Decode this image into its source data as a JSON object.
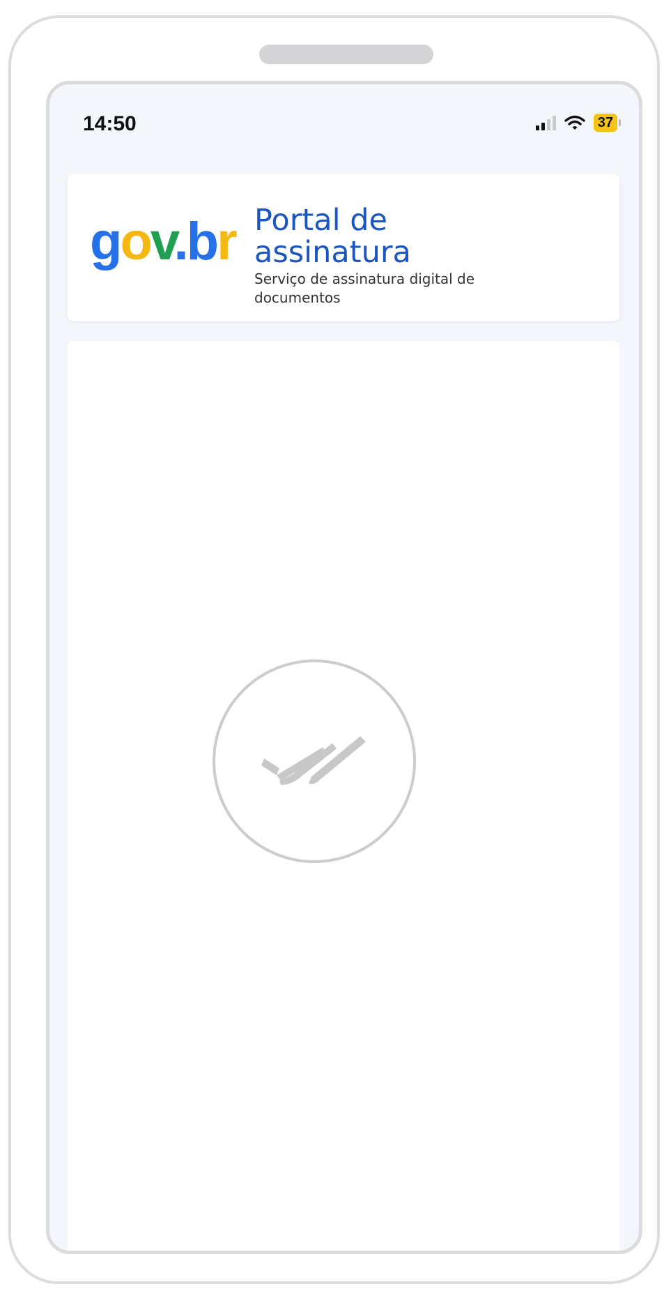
{
  "status_bar": {
    "time": "14:50",
    "battery_level": "37",
    "signal_bars_filled": 2,
    "signal_bars_total": 4
  },
  "header": {
    "logo": {
      "g": "g",
      "o": "o",
      "v": "v",
      "dot": ".",
      "b": "b",
      "r": "r"
    },
    "title": "Portal de assinatura",
    "subtitle": "Serviço de assinatura digital de documentos"
  },
  "content": {
    "status_icon": "double-check-icon"
  },
  "colors": {
    "gov_blue": "#2670e8",
    "gov_yellow": "#f5b711",
    "gov_green": "#1ea050",
    "title_blue": "#1b56c0",
    "battery_yellow": "#f4c313",
    "icon_gray": "#c8c8c8"
  }
}
